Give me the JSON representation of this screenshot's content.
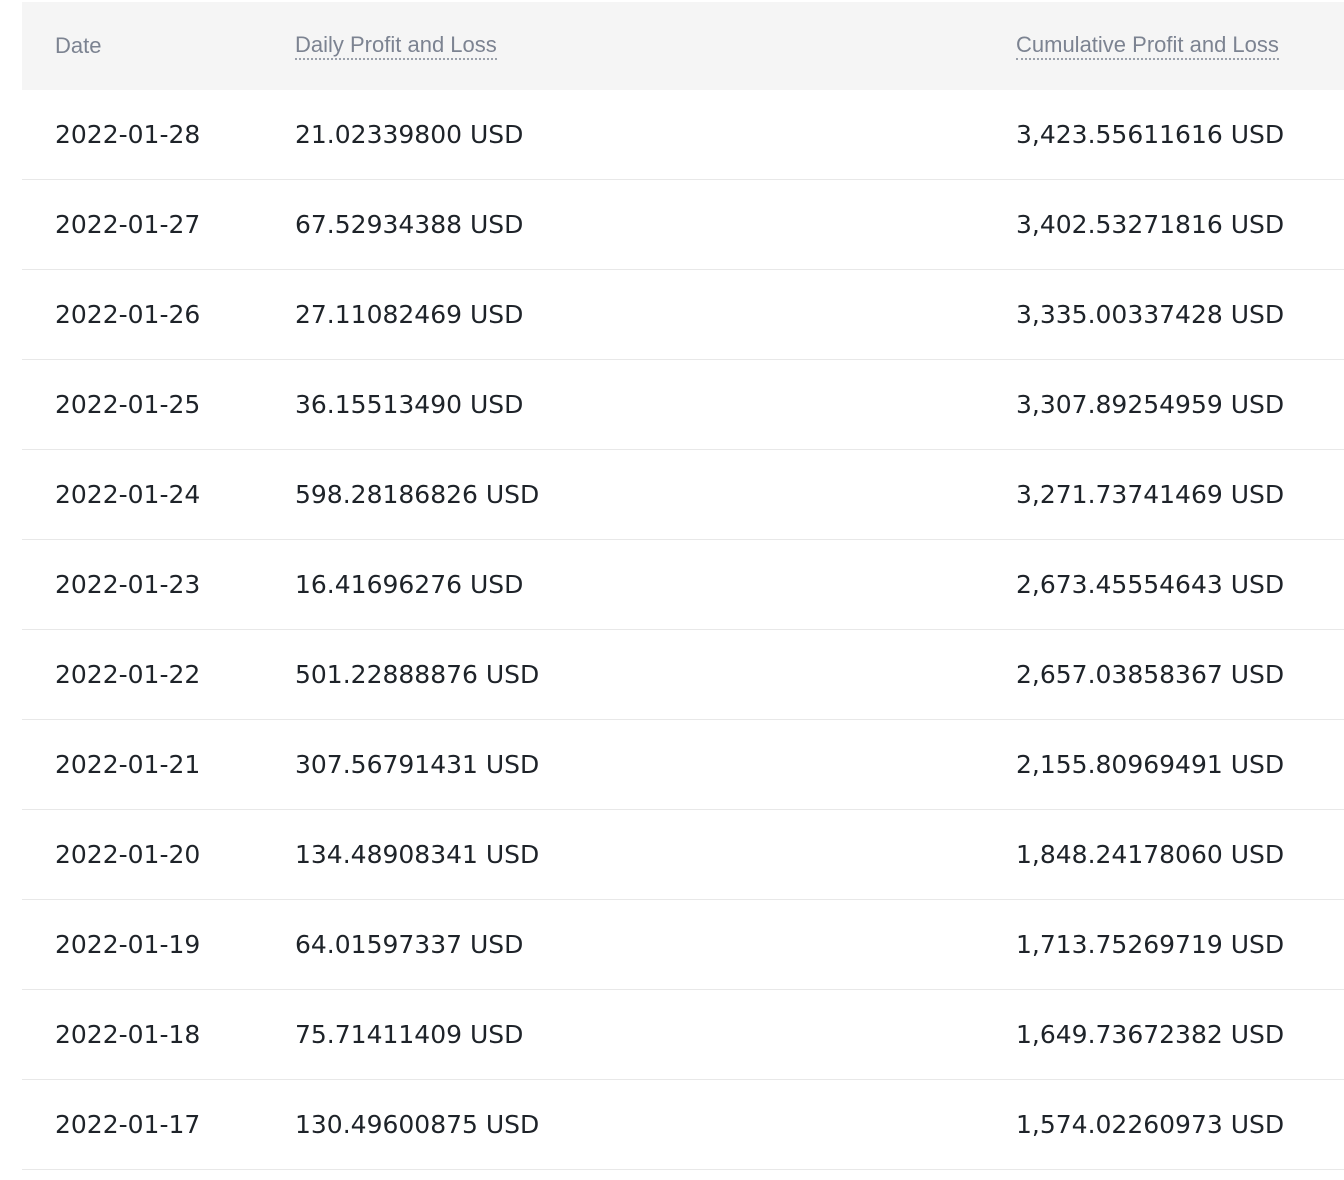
{
  "table": {
    "headers": {
      "date": "Date",
      "daily": "Daily Profit and Loss",
      "cumulative": "Cumulative Profit and Loss"
    },
    "rows": [
      {
        "date": "2022-01-28",
        "daily": "21.02339800 USD",
        "cumulative": "3,423.55611616 USD"
      },
      {
        "date": "2022-01-27",
        "daily": "67.52934388 USD",
        "cumulative": "3,402.53271816 USD"
      },
      {
        "date": "2022-01-26",
        "daily": "27.11082469 USD",
        "cumulative": "3,335.00337428 USD"
      },
      {
        "date": "2022-01-25",
        "daily": "36.15513490 USD",
        "cumulative": "3,307.89254959 USD"
      },
      {
        "date": "2022-01-24",
        "daily": "598.28186826 USD",
        "cumulative": "3,271.73741469 USD"
      },
      {
        "date": "2022-01-23",
        "daily": "16.41696276 USD",
        "cumulative": "2,673.45554643 USD"
      },
      {
        "date": "2022-01-22",
        "daily": "501.22888876 USD",
        "cumulative": "2,657.03858367 USD"
      },
      {
        "date": "2022-01-21",
        "daily": "307.56791431 USD",
        "cumulative": "2,155.80969491 USD"
      },
      {
        "date": "2022-01-20",
        "daily": "134.48908341 USD",
        "cumulative": "1,848.24178060 USD"
      },
      {
        "date": "2022-01-19",
        "daily": "64.01597337 USD",
        "cumulative": "1,713.75269719 USD"
      },
      {
        "date": "2022-01-18",
        "daily": "75.71411409 USD",
        "cumulative": "1,649.73672382 USD"
      },
      {
        "date": "2022-01-17",
        "daily": "130.49600875 USD",
        "cumulative": "1,574.02260973 USD"
      }
    ]
  }
}
